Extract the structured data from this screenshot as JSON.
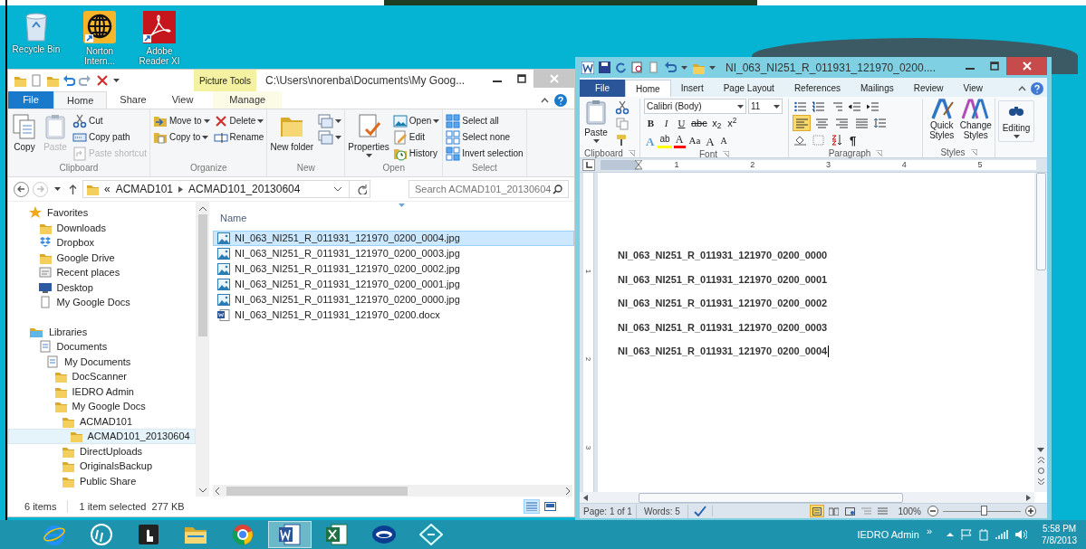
{
  "desktop_icons": [
    {
      "label": "Recycle Bin"
    },
    {
      "label": "Norton Intern..."
    },
    {
      "label": "Adobe Reader XI"
    }
  ],
  "explorer": {
    "contextual_tab": "Picture Tools",
    "title": "C:\\Users\\norenba\\Documents\\My Goog...",
    "tabs": [
      {
        "label": "File",
        "kind": "file",
        "selected": false
      },
      {
        "label": "Home",
        "kind": "tab",
        "selected": true
      },
      {
        "label": "Share",
        "kind": "tab",
        "selected": false
      },
      {
        "label": "View",
        "kind": "tab",
        "selected": false
      },
      {
        "label": "Manage",
        "kind": "contextual",
        "selected": false
      }
    ],
    "ribbon": [
      {
        "label": "Clipboard",
        "items": [
          {
            "label": "Copy",
            "kind": "large",
            "disabled": false
          },
          {
            "label": "Paste",
            "kind": "large",
            "disabled": true
          },
          {
            "label": "Cut",
            "kind": "small",
            "disabled": false
          },
          {
            "label": "Copy path",
            "kind": "small",
            "disabled": false
          },
          {
            "label": "Paste shortcut",
            "kind": "small",
            "disabled": true
          }
        ]
      },
      {
        "label": "Organize",
        "items": [
          {
            "label": "Move to",
            "kind": "small",
            "menu": true,
            "disabled": false
          },
          {
            "label": "Copy to",
            "kind": "small",
            "menu": true,
            "disabled": false
          },
          {
            "label": "Delete",
            "kind": "small",
            "menu": true,
            "disabled": false
          },
          {
            "label": "Rename",
            "kind": "small",
            "disabled": false
          }
        ]
      },
      {
        "label": "New",
        "items": [
          {
            "label": "New folder",
            "kind": "large",
            "disabled": false
          },
          {
            "kind": "small",
            "menu": true,
            "disabled": false
          },
          {
            "kind": "small",
            "menu": true,
            "disabled": false
          }
        ]
      },
      {
        "label": "Open",
        "items": [
          {
            "label": "Properties",
            "kind": "large",
            "menu": true,
            "disabled": false
          },
          {
            "label": "Open",
            "kind": "small",
            "menu": true,
            "disabled": false
          },
          {
            "label": "Edit",
            "kind": "small",
            "disabled": false
          },
          {
            "label": "History",
            "kind": "small",
            "disabled": false
          }
        ]
      },
      {
        "label": "Select",
        "items": [
          {
            "label": "Select all",
            "kind": "small",
            "disabled": false
          },
          {
            "label": "Select none",
            "kind": "small",
            "disabled": false
          },
          {
            "label": "Invert selection",
            "kind": "small",
            "disabled": false
          }
        ]
      }
    ],
    "address_overflow": "«",
    "address": [
      "ACMAD101",
      "ACMAD101_20130604"
    ],
    "search": {
      "placeholder": "Search ACMAD101_20130604"
    },
    "tree": [
      {
        "label": "Favorites",
        "kind": "star",
        "selected": false,
        "children": [
          {
            "label": "Downloads",
            "kind": "folder",
            "selected": false
          },
          {
            "label": "Dropbox",
            "kind": "dropbox",
            "selected": false
          },
          {
            "label": "Google Drive",
            "kind": "folder",
            "selected": false
          },
          {
            "label": "Recent places",
            "kind": "recent",
            "selected": false
          },
          {
            "label": "Desktop",
            "kind": "desktop",
            "selected": false
          },
          {
            "label": "My Google Docs",
            "kind": "page",
            "selected": false
          }
        ]
      },
      {
        "label": "Libraries",
        "kind": "library",
        "selected": false,
        "children": [
          {
            "label": "Documents",
            "kind": "documents",
            "selected": false,
            "children": [
              {
                "label": "My Documents",
                "kind": "documents",
                "selected": false,
                "children": [
                  {
                    "label": "DocScanner",
                    "kind": "folder",
                    "selected": false
                  },
                  {
                    "label": "IEDRO Admin",
                    "kind": "folder",
                    "selected": false
                  },
                  {
                    "label": "My Google Docs",
                    "kind": "folder",
                    "selected": false,
                    "children": [
                      {
                        "label": "ACMAD101",
                        "kind": "folder",
                        "selected": false,
                        "children": [
                          {
                            "label": "ACMAD101_20130604",
                            "kind": "folder",
                            "selected": true
                          }
                        ]
                      },
                      {
                        "label": "DirectUploads",
                        "kind": "folder",
                        "selected": false
                      },
                      {
                        "label": "OriginalsBackup",
                        "kind": "folder",
                        "selected": false
                      },
                      {
                        "label": "Public Share",
                        "kind": "folder",
                        "selected": false
                      }
                    ]
                  }
                ]
              }
            ]
          }
        ]
      }
    ],
    "column": "Name",
    "files": [
      {
        "name": "NI_063_NI251_R_011931_121970_0200_0004.jpg",
        "kind": "image",
        "selected": true
      },
      {
        "name": "NI_063_NI251_R_011931_121970_0200_0003.jpg",
        "kind": "image",
        "selected": false
      },
      {
        "name": "NI_063_NI251_R_011931_121970_0200_0002.jpg",
        "kind": "image",
        "selected": false
      },
      {
        "name": "NI_063_NI251_R_011931_121970_0200_0001.jpg",
        "kind": "image",
        "selected": false
      },
      {
        "name": "NI_063_NI251_R_011931_121970_0200_0000.jpg",
        "kind": "image",
        "selected": false
      },
      {
        "name": "NI_063_NI251_R_011931_121970_0200.docx",
        "kind": "document",
        "selected": false
      }
    ],
    "status": [
      "6 items",
      "1 item selected  277 KB"
    ]
  },
  "word": {
    "title": "NI_063_NI251_R_011931_121970_0200....",
    "tabs": [
      {
        "label": "File",
        "kind": "file",
        "selected": false
      },
      {
        "label": "Home",
        "kind": "tab",
        "selected": true
      },
      {
        "label": "Insert",
        "kind": "tab",
        "selected": false
      },
      {
        "label": "Page Layout",
        "kind": "tab",
        "selected": false
      },
      {
        "label": "References",
        "kind": "tab",
        "selected": false
      },
      {
        "label": "Mailings",
        "kind": "tab",
        "selected": false
      },
      {
        "label": "Review",
        "kind": "tab",
        "selected": false
      },
      {
        "label": "View",
        "kind": "tab",
        "selected": false
      }
    ],
    "paste": "Paste",
    "font": "Calibri (Body)",
    "size": "11",
    "format_buttons": [
      "B",
      "I",
      "U",
      "abc",
      "x$_{2}$",
      "x$^{2}$"
    ],
    "font_buttons": [
      {
        "text": "A",
        "kind": "effects"
      },
      {
        "text": "ab",
        "kind": "highlight"
      },
      {
        "text": "A",
        "kind": "color"
      },
      {
        "text": "Aa",
        "kind": "case"
      },
      {
        "text": "A",
        "kind": "grow"
      },
      {
        "text": "A",
        "kind": "shrink"
      }
    ],
    "alignment": [
      {
        "selected": true
      },
      {
        "selected": false
      },
      {
        "selected": false
      },
      {
        "selected": false
      }
    ],
    "pilcrow": "¶",
    "styles": [
      {
        "label": "Quick Styles"
      },
      {
        "label": "Change Styles"
      }
    ],
    "editing": "Editing",
    "groups": [
      "Clipboard",
      "Font",
      "Paragraph",
      "Styles"
    ],
    "ruler_numbers": [
      "1",
      "2",
      "3",
      "4",
      "5"
    ],
    "vruler_numbers": [
      "1",
      "2",
      "3"
    ],
    "lines": [
      "NI_063_NI251_R_011931_121970_0200_0000",
      "NI_063_NI251_R_011931_121970_0200_0001",
      "NI_063_NI251_R_011931_121970_0200_0002",
      "NI_063_NI251_R_011931_121970_0200_0003",
      "NI_063_NI251_R_011931_121970_0200_0004"
    ],
    "page": "Page: 1 of 1",
    "words": "Words: 5",
    "zoom": "100%",
    "zoom_slider": {
      "level": 0.52
    }
  },
  "taskbar": {
    "apps": [
      {
        "active": false
      },
      {
        "active": false
      },
      {
        "active": false
      },
      {
        "active": false
      },
      {
        "active": false
      },
      {
        "active": true
      },
      {
        "active": false
      },
      {
        "active": false
      },
      {
        "active": false
      }
    ],
    "user": "IEDRO Admin",
    "overflow": "»",
    "time": "5:58 PM",
    "date": "7/8/2013"
  }
}
